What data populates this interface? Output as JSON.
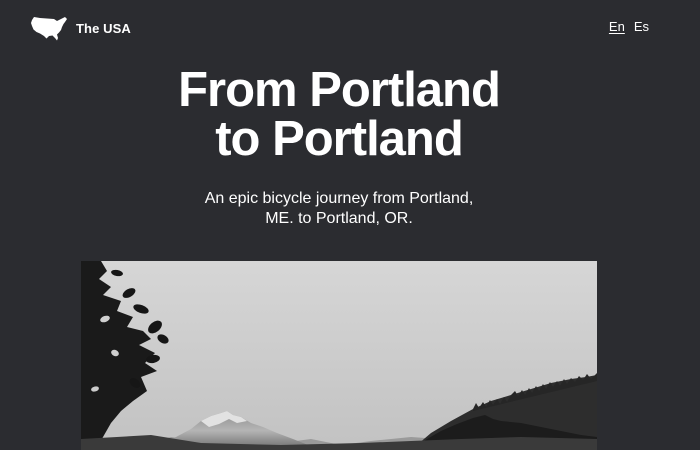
{
  "header": {
    "brand_name": "The USA",
    "brand_logo_icon": "usa-map-icon",
    "languages": [
      "En",
      "Es"
    ],
    "active_language": "En"
  },
  "hero": {
    "title_line1": "From Portland",
    "title_line2": "to Portland",
    "subtitle_line1": "An epic bicycle journey from Portland,",
    "subtitle_line2": "ME. to Portland, OR."
  },
  "photo": {
    "subject": "black-and-white mountain landscape with trees"
  },
  "colors": {
    "background": "#2b2c30",
    "text": "#ffffff"
  }
}
